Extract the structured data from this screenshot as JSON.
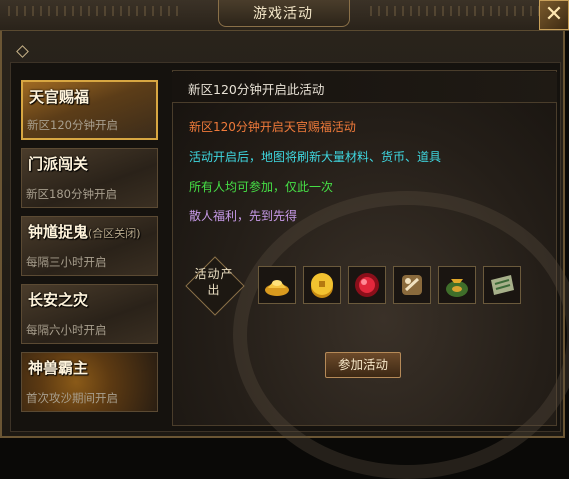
{
  "window": {
    "title": "游戏活动",
    "close_icon": "close-icon"
  },
  "tabs": [
    {
      "name": "天官赐福",
      "note": "",
      "sub": "新区120分钟开启",
      "active": true
    },
    {
      "name": "门派闯关",
      "note": "",
      "sub": "新区180分钟开启",
      "active": false
    },
    {
      "name": "钟馗捉鬼",
      "note": "(合区关闭)",
      "sub": "每隔三小时开启",
      "active": false
    },
    {
      "name": "长安之灾",
      "note": "",
      "sub": "每隔六小时开启",
      "active": false
    },
    {
      "name": "神兽霸主",
      "note": "",
      "sub": "首次攻沙期间开启",
      "active": false
    }
  ],
  "detail": {
    "header": "新区120分钟开启此活动",
    "lines": [
      {
        "text": "新区120分钟开启天官赐福活动",
        "color": "#f07a3a"
      },
      {
        "text": "活动开启后，地图将刷新大量材料、货币、道具",
        "color": "#3fd7e0"
      },
      {
        "text": "所有人均可参加，仅此一次",
        "color": "#46e046"
      },
      {
        "text": "散人福利，先到先得",
        "color": "#c79ae8"
      }
    ],
    "output_label": "活动产出",
    "items": [
      {
        "icon": "gold-ingot-icon"
      },
      {
        "icon": "gold-coin-icon"
      },
      {
        "icon": "red-gem-icon"
      },
      {
        "icon": "scroll-icon"
      },
      {
        "icon": "money-bag-icon"
      },
      {
        "icon": "map-scroll-icon"
      }
    ],
    "join_label": "参加活动"
  },
  "colors": {
    "accent": "#d8a742",
    "frame": "#6b5634"
  }
}
